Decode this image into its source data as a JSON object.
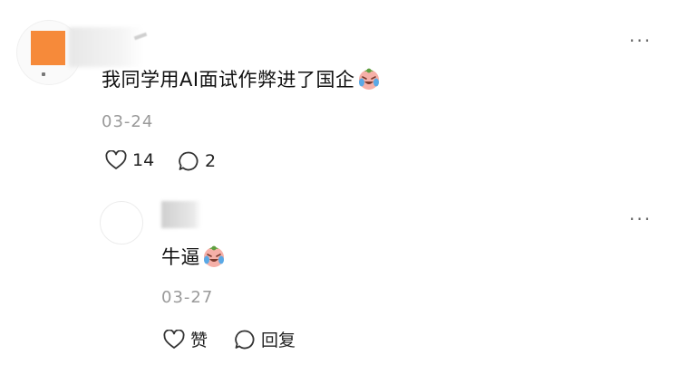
{
  "comment": {
    "text": "我同学用AI面试作弊进了国企",
    "date": "03-24",
    "like_count": "14",
    "reply_count": "2",
    "more_label": "···",
    "emoji_icon": "crying-laughing-face-icon",
    "avatar_color": "#f68a3a"
  },
  "reply": {
    "text": "牛逼",
    "date": "03-27",
    "like_label": "赞",
    "reply_label": "回复",
    "more_label": "···",
    "emoji_icon": "crying-laughing-face-icon"
  }
}
